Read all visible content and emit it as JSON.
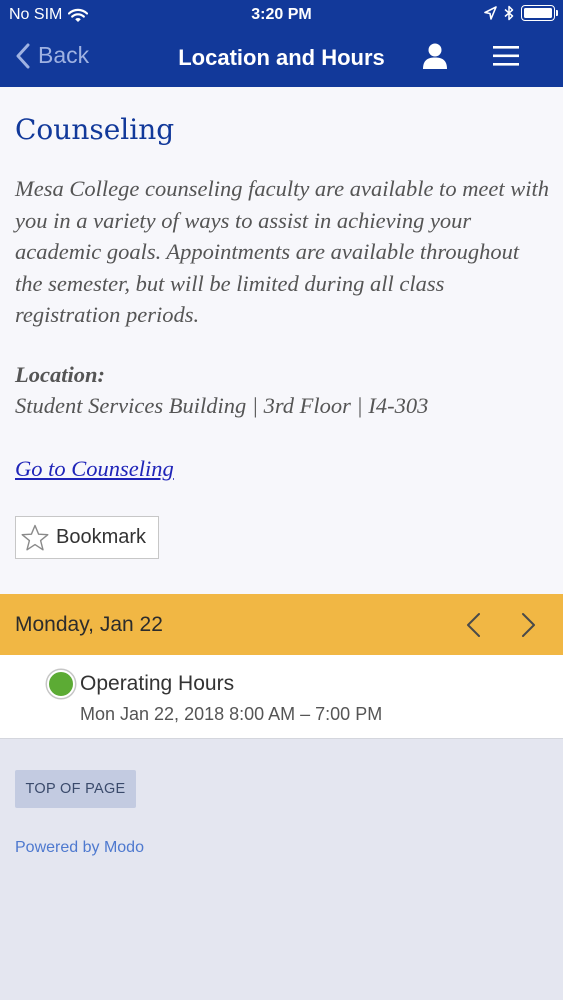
{
  "status_bar": {
    "carrier": "No SIM",
    "time": "3:20 PM"
  },
  "nav": {
    "back_label": "Back",
    "title": "Location and Hours",
    "icons": [
      "chevron-left-icon",
      "user-icon",
      "hamburger-menu-icon"
    ]
  },
  "content": {
    "title": "Counseling",
    "description": "Mesa College counseling faculty are available to meet with you in a variety of ways to assist in achieving your academic goals. Appointments are available throughout the semester, but will be limited during all class registration periods.",
    "location_label": "Location:",
    "location_value": "Student Services Building | 3rd Floor | I4-303",
    "link_label": "Go to Counseling",
    "bookmark_label": "Bookmark"
  },
  "date_bar": {
    "date": "Monday, Jan 22"
  },
  "hours": {
    "title": "Operating Hours",
    "time": "Mon Jan 22, 2018 8:00 AM – 7:00 PM",
    "status_color": "#5cab34"
  },
  "footer": {
    "top_button": "TOP OF PAGE",
    "powered_by": "Powered by Modo"
  },
  "colors": {
    "header": "#12399a",
    "date_bar": "#f1b744",
    "link": "#1f24b8",
    "footer_bg": "#e4e6f0"
  }
}
